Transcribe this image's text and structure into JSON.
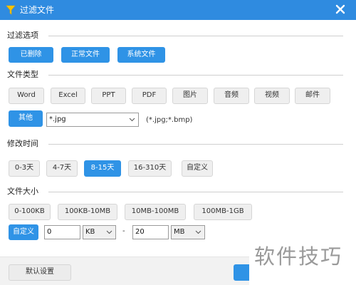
{
  "window": {
    "title": "过滤文件"
  },
  "filter_options": {
    "heading": "过滤选项",
    "buttons": [
      "已删除",
      "正常文件",
      "系统文件"
    ]
  },
  "file_type": {
    "heading": "文件类型",
    "buttons": [
      "Word",
      "Excel",
      "PPT",
      "PDF",
      "图片",
      "音频",
      "视频",
      "邮件"
    ],
    "other_label": "其他",
    "other_value": "*.jpg",
    "other_hint": "(*.jpg;*.bmp)"
  },
  "modified_time": {
    "heading": "修改时间",
    "buttons": [
      "0-3天",
      "4-7天",
      "8-15天",
      "16-310天",
      "自定义"
    ],
    "selected": "8-15天"
  },
  "file_size": {
    "heading": "文件大小",
    "buttons": [
      "0-100KB",
      "100KB-10MB",
      "10MB-100MB",
      "100MB-1GB"
    ],
    "custom_label": "自定义",
    "min_value": "0",
    "min_unit": "KB",
    "separator": "-",
    "max_value": "20",
    "max_unit": "MB"
  },
  "footer": {
    "default_button": "默认设置"
  },
  "watermark": "软件技巧",
  "colors": {
    "accent": "#2f93e6",
    "titlebar": "#2f8be0"
  },
  "icons": {
    "title": "funnel-icon",
    "close": "close-icon",
    "dropdown": "chevron-down-icon"
  }
}
